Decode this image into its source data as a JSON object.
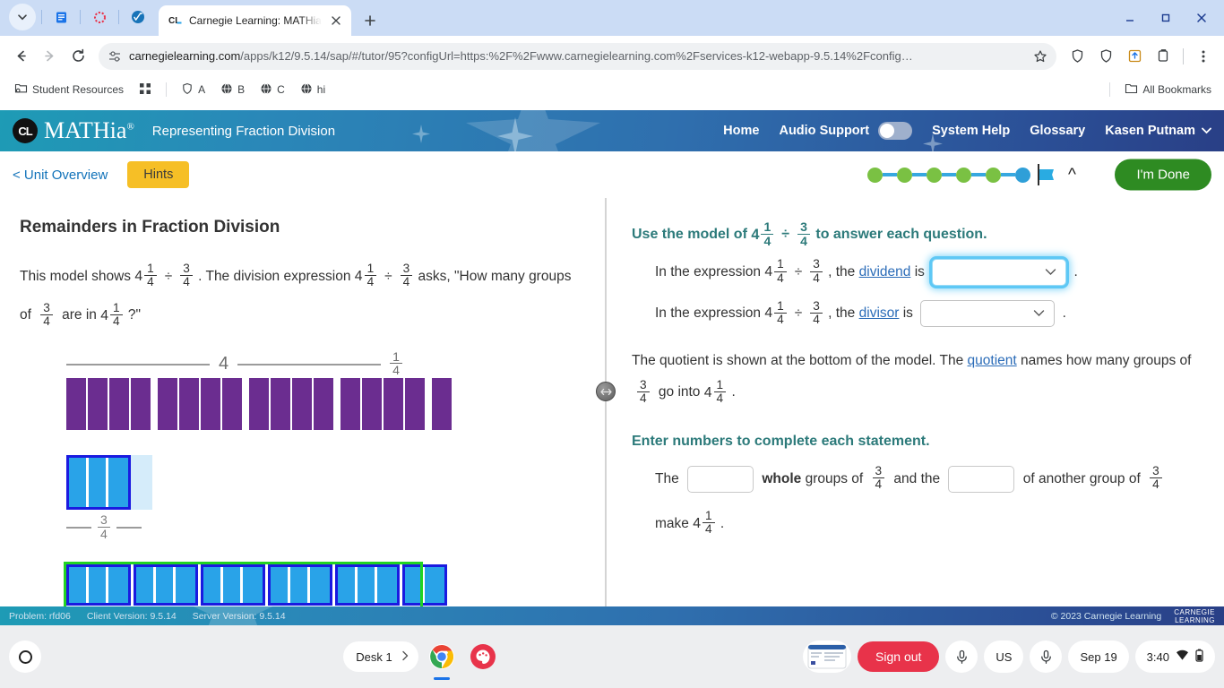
{
  "browser": {
    "tab": {
      "title": "Carnegie Learning: MATHia - Re",
      "favicon": "carnegie-learning-favicon",
      "close_icon": "close-icon"
    },
    "pinned_icons": [
      "chevron-down-icon",
      "reading-list-icon",
      "record-icon",
      "math-app-icon"
    ],
    "new_tab_label": "+",
    "window_controls": {
      "minimize": "minimize-icon",
      "maximize": "maximize-icon",
      "close": "close-icon"
    },
    "nav": {
      "back": "back-arrow-icon",
      "forward": "forward-arrow-icon",
      "reload": "reload-icon"
    },
    "omnibox": {
      "site_settings_icon": "tune-icon",
      "domain": "carnegielearning.com",
      "path": "/apps/k12/9.5.14/sap/#/tutor/95?configUrl=https:%2F%2Fwww.carnegielearning.com%2Fservices-k12-webapp-9.5.14%2Fconfig…",
      "bookmark_icon": "star-icon"
    },
    "toolbar_icons": [
      "shield-icon",
      "shield-icon",
      "install-icon",
      "clipboard-icon",
      "kebab-menu-icon"
    ],
    "bookmarks": [
      {
        "label": "Student Resources",
        "icon": "folder-gear-icon"
      },
      {
        "label": "",
        "icon": "apps-grid-icon"
      },
      {
        "label": "A",
        "icon": "shield-icon"
      },
      {
        "label": "B",
        "icon": "globe-icon"
      },
      {
        "label": "C",
        "icon": "globe-icon"
      },
      {
        "label": "hi",
        "icon": "globe-icon"
      }
    ],
    "all_bookmarks": {
      "label": "All Bookmarks",
      "icon": "folder-icon"
    }
  },
  "app": {
    "logo": {
      "badge": "CL",
      "name": "MATHia",
      "registered": "®"
    },
    "module_title": "Representing Fraction Division",
    "nav": {
      "home": "Home",
      "audio_support": "Audio Support",
      "system_help": "System Help",
      "glossary": "Glossary",
      "user": "Kasen Putnam",
      "user_caret": "chevron-down-icon"
    },
    "subbar": {
      "unit_overview": "< Unit Overview",
      "hints": "Hints",
      "done": "I'm Done",
      "collapse_icon": "chevron-up-icon",
      "flag_icon": "flag-icon"
    },
    "progress": {
      "dots": [
        "done",
        "done",
        "done",
        "done",
        "done",
        "current"
      ],
      "colors": {
        "done": "#7ac143",
        "current": "#2f9fd8",
        "line": "#37a8e0"
      }
    },
    "footer": {
      "problem": "Problem: rfd06",
      "client_version": "Client Version: 9.5.14",
      "server_version": "Server Version: 9.5.14",
      "copyright": "© 2023 Carnegie Learning",
      "brand_line1": "CARNEGIE",
      "brand_line2": "LEARNING"
    }
  },
  "left_panel": {
    "title": "Remainders in Fraction Division",
    "text": {
      "p1_a": "This model shows",
      "p1_b": ". The division expression",
      "p1_c": "asks, \"How many",
      "p2_a": "groups of",
      "p2_b": "are in",
      "p2_c": "?\""
    },
    "expression": {
      "dividend_whole": "4",
      "dividend_num": "1",
      "dividend_den": "4",
      "operator": "÷",
      "divisor_num": "3",
      "divisor_den": "4"
    },
    "model": {
      "brace_whole_label": "4",
      "brace_frac_num": "1",
      "brace_frac_den": "4",
      "purple_groups": [
        4,
        4,
        4,
        4,
        1
      ],
      "purple_color": "#6b2d90",
      "blue_group_label_num": "3",
      "blue_group_label_den": "4",
      "blue_filled_cells": 3,
      "blue_empty_cells": 1,
      "blue_color": "#29a3e8",
      "blue_border_color": "#1a1ae0",
      "bottom_groups": [
        3,
        3,
        3,
        3,
        3,
        2
      ],
      "green_outline_color": "#22d422"
    }
  },
  "right_panel": {
    "heading": {
      "a": "Use the model of",
      "b": "to answer each question."
    },
    "q1": {
      "a": "In the expression",
      "b": ", the",
      "link": "dividend",
      "c": "is",
      "period": ".",
      "select_value": "",
      "focused": true
    },
    "q2": {
      "a": "In the expression",
      "b": ", the",
      "link": "divisor",
      "c": "is",
      "period": ".",
      "select_value": "",
      "focused": false
    },
    "quotient_para": {
      "a": "The quotient is shown at the bottom of the model. The",
      "link": "quotient",
      "b": "names how many",
      "c": "groups of",
      "d": "go into",
      "e": "."
    },
    "section_heading": "Enter numbers to complete each statement.",
    "statement": {
      "a": "The",
      "bold": "whole",
      "b": "groups of",
      "c": "and the",
      "d": "of another group of",
      "e": "make",
      "f": ".",
      "input1_value": "",
      "input2_value": ""
    }
  },
  "taskbar": {
    "launcher_icon": "launcher-icon",
    "desk": {
      "label": "Desk 1",
      "chevron": "chevron-right-icon"
    },
    "apps": [
      "chrome-icon",
      "paint-icon"
    ],
    "thumbnail": "window-thumbnail",
    "sign_out": "Sign out",
    "mic_icon": "microphone-icon",
    "keyboard_lang": "US",
    "mic_icon_2": "microphone-icon",
    "date": "Sep 19",
    "time": "3:40",
    "wifi_icon": "wifi-icon",
    "battery_icon": "battery-icon"
  }
}
